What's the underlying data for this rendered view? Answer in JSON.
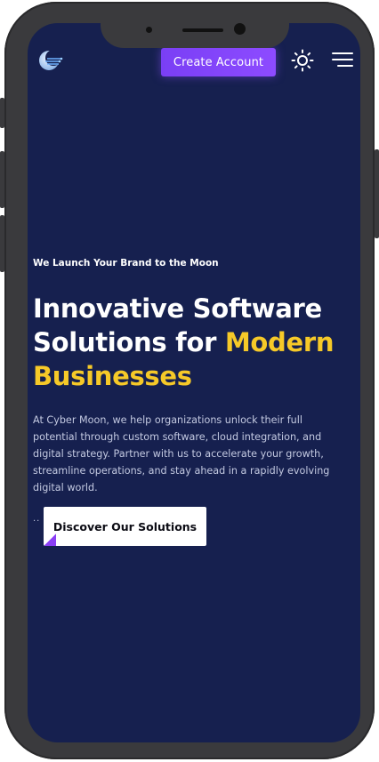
{
  "header": {
    "create_account_label": "Create Account"
  },
  "hero": {
    "tagline": "We Launch Your Brand to the Moon",
    "headline_part1": "Innovative Software Solutions for ",
    "headline_accent": "Modern Businesses",
    "description": "At Cyber Moon, we help organizations unlock their full potential through custom software, cloud integration, and digital strategy. Partner with us to accelerate your growth, streamline operations, and stay ahead in a rapidly evolving digital world.",
    "dots": "..",
    "cta_label": "Discover Our Solutions"
  },
  "icons": {
    "logo": "moon-logo-icon",
    "theme": "sun-icon",
    "menu": "hamburger-menu-icon"
  },
  "colors": {
    "background": "#16204f",
    "accent_yellow": "#f6c928",
    "button_purple": "#8047f7",
    "text_muted": "#c3c9e1"
  }
}
